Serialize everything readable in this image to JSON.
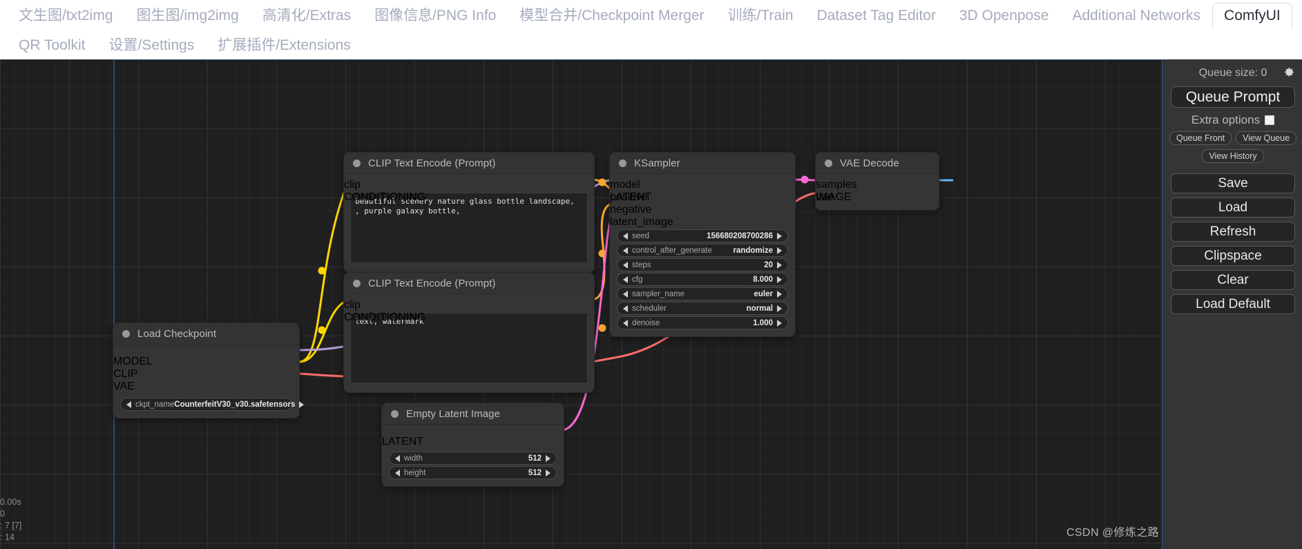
{
  "tabs_row1": [
    {
      "label": "文生图/txt2img",
      "active": false
    },
    {
      "label": "图生图/img2img",
      "active": false
    },
    {
      "label": "高清化/Extras",
      "active": false
    },
    {
      "label": "图像信息/PNG Info",
      "active": false
    },
    {
      "label": "模型合并/Checkpoint Merger",
      "active": false
    },
    {
      "label": "训练/Train",
      "active": false
    },
    {
      "label": "Dataset Tag Editor",
      "active": false
    },
    {
      "label": "3D Openpose",
      "active": false
    },
    {
      "label": "Additional Networks",
      "active": false
    },
    {
      "label": "ComfyUI",
      "active": true
    }
  ],
  "tabs_row2": [
    {
      "label": "QR Toolkit",
      "active": false
    },
    {
      "label": "设置/Settings",
      "active": false
    },
    {
      "label": "扩展插件/Extensions",
      "active": false
    }
  ],
  "sidebar": {
    "queue_size": "Queue size: 0",
    "gear_icon": "gear-icon",
    "queue_prompt": "Queue Prompt",
    "extra_options": "Extra options",
    "queue_front": "Queue Front",
    "view_queue": "View Queue",
    "view_history": "View History",
    "save": "Save",
    "load": "Load",
    "refresh": "Refresh",
    "clipspace": "Clipspace",
    "clear": "Clear",
    "load_default": "Load Default"
  },
  "nodes": {
    "clip_positive": {
      "title": "CLIP Text Encode (Prompt)",
      "input_clip": "clip",
      "output_conditioning": "CONDITIONING",
      "text": "beautiful scenery nature glass bottle landscape, , purple galaxy bottle,"
    },
    "clip_negative": {
      "title": "CLIP Text Encode (Prompt)",
      "input_clip": "clip",
      "output_conditioning": "CONDITIONING",
      "text": "text, watermark"
    },
    "ksampler": {
      "title": "KSampler",
      "in_model": "model",
      "in_positive": "positive",
      "in_negative": "negative",
      "in_latent": "latent_image",
      "out_latent": "LATENT",
      "widgets": [
        {
          "name": "seed",
          "value": "156680208700286"
        },
        {
          "name": "control_after_generate",
          "value": "randomize"
        },
        {
          "name": "steps",
          "value": "20"
        },
        {
          "name": "cfg",
          "value": "8.000"
        },
        {
          "name": "sampler_name",
          "value": "euler"
        },
        {
          "name": "scheduler",
          "value": "normal"
        },
        {
          "name": "denoise",
          "value": "1.000"
        }
      ]
    },
    "vae_decode": {
      "title": "VAE Decode",
      "in_samples": "samples",
      "in_vae": "vae",
      "out_image": "IMAGE"
    },
    "load_checkpoint": {
      "title": "Load Checkpoint",
      "out_model": "MODEL",
      "out_clip": "CLIP",
      "out_vae": "VAE",
      "widget_name": "ckpt_name",
      "widget_value": "CounterfeitV30_v30.safetensors"
    },
    "empty_latent": {
      "title": "Empty Latent Image",
      "out_latent": "LATENT",
      "widgets": [
        {
          "name": "width",
          "value": "512"
        },
        {
          "name": "height",
          "value": "512"
        }
      ]
    }
  },
  "status_overlay": "0.00s\n0\n: 7 [7]\n: 14",
  "watermark": "CSDN @修炼之路",
  "colors": {
    "pin_clip": "#FFD500",
    "pin_conditioning": "#FFA931",
    "pin_model": "#B39DDB",
    "pin_latent": "#FF6AD5",
    "pin_vae": "#FF6E6E",
    "pin_image": "#64B5F6",
    "canvas_bg": "#1f1f1f",
    "node_bg": "#353535"
  }
}
